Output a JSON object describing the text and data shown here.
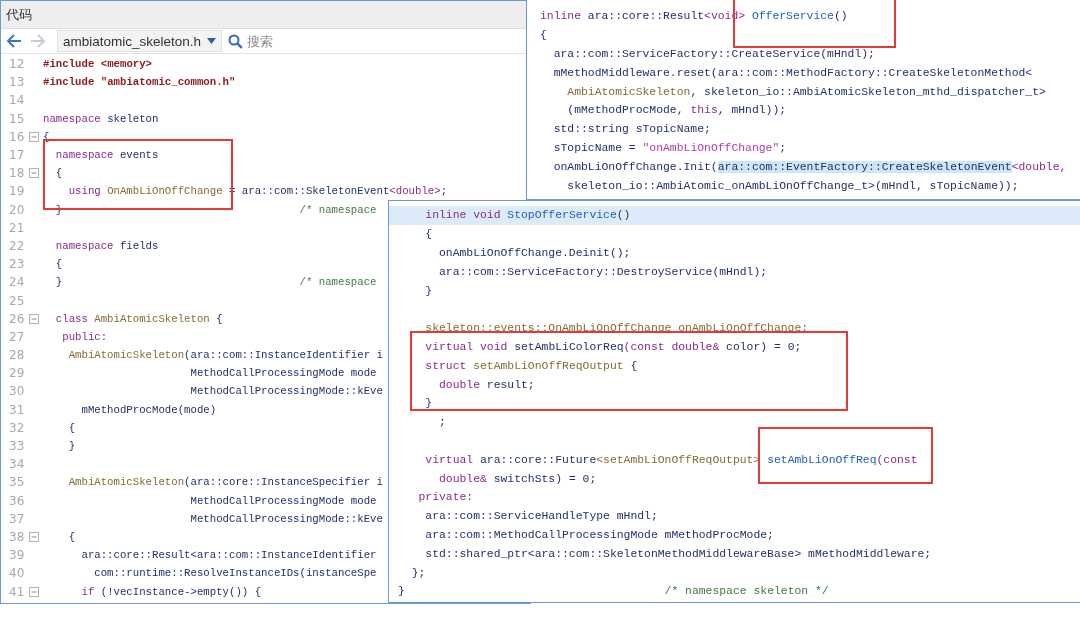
{
  "editor": {
    "title": "代码",
    "back_enabled": true,
    "forward_enabled": false,
    "file": "ambiatomic_skeleton.h",
    "search_placeholder": "搜索",
    "lines": [
      {
        "number": "12",
        "code": [
          {
            "text": "#include <memory>",
            "kind": "pp"
          }
        ]
      },
      {
        "number": "13",
        "code": [
          {
            "text": "#include \"ambiatomic_common.h\"",
            "kind": "pp"
          }
        ]
      },
      {
        "number": "14"
      },
      {
        "number": "15",
        "code": [
          {
            "text": "namespace ",
            "kind": "kw"
          },
          {
            "text": "skeleton",
            "kind": "id"
          }
        ]
      },
      {
        "number": "16",
        "expanded": true,
        "code": [
          {
            "text": "{",
            "kind": "id"
          }
        ]
      },
      {
        "number": "17",
        "code": [
          {
            "text": "  namespace ",
            "kind": "kw"
          },
          {
            "text": "events",
            "kind": "id"
          }
        ]
      },
      {
        "number": "18",
        "expanded": true,
        "code": [
          {
            "text": "  {",
            "kind": "id"
          }
        ]
      },
      {
        "number": "19",
        "code": [
          {
            "text": "    using ",
            "kind": "kw"
          },
          {
            "text": "OnAmbLiOnOffChange",
            "kind": "ty"
          },
          {
            "text": " = ara::com::SkeletonEvent",
            "kind": "id"
          },
          {
            "text": "<double>",
            "kind": "kw"
          },
          {
            "text": ";",
            "kind": "id"
          }
        ]
      },
      {
        "number": "20",
        "code": [
          {
            "text": "  }                                     ",
            "kind": "id"
          },
          {
            "text": "/* namespace",
            "kind": "cm"
          }
        ]
      },
      {
        "number": "21"
      },
      {
        "number": "22",
        "code": [
          {
            "text": "  namespace ",
            "kind": "kw"
          },
          {
            "text": "fields",
            "kind": "id"
          }
        ]
      },
      {
        "number": "23",
        "code": [
          {
            "text": "  {",
            "kind": "id"
          }
        ]
      },
      {
        "number": "24",
        "code": [
          {
            "text": "  }                                     ",
            "kind": "id"
          },
          {
            "text": "/* namespace",
            "kind": "cm"
          }
        ]
      },
      {
        "number": "25"
      },
      {
        "number": "26",
        "expanded": true,
        "code": [
          {
            "text": "  class ",
            "kind": "kw"
          },
          {
            "text": "AmbiAtomicSkeleton",
            "kind": "ty"
          },
          {
            "text": " {",
            "kind": "id"
          }
        ]
      },
      {
        "number": "27",
        "code": [
          {
            "text": "   public:",
            "kind": "kw"
          }
        ]
      },
      {
        "number": "28",
        "code": [
          {
            "text": "    AmbiAtomicSkeleton",
            "kind": "ty"
          },
          {
            "text": "(ara::com::InstanceIdentifier i",
            "kind": "id"
          }
        ]
      },
      {
        "number": "29",
        "code": [
          {
            "text": "                       MethodCallProcessingMode mode",
            "kind": "id"
          }
        ]
      },
      {
        "number": "30",
        "code": [
          {
            "text": "                       MethodCallProcessingMode::kEve",
            "kind": "id"
          }
        ]
      },
      {
        "number": "31",
        "code": [
          {
            "text": "      mMethodProcMode(mode)",
            "kind": "id"
          }
        ]
      },
      {
        "number": "32",
        "code": [
          {
            "text": "    {",
            "kind": "id"
          }
        ]
      },
      {
        "number": "33",
        "code": [
          {
            "text": "    }",
            "kind": "id"
          }
        ]
      },
      {
        "number": "34"
      },
      {
        "number": "35",
        "code": [
          {
            "text": "    AmbiAtomicSkeleton",
            "kind": "ty"
          },
          {
            "text": "(ara::core::InstanceSpecifier i",
            "kind": "id"
          }
        ]
      },
      {
        "number": "36",
        "code": [
          {
            "text": "                       MethodCallProcessingMode mode",
            "kind": "id"
          }
        ]
      },
      {
        "number": "37",
        "code": [
          {
            "text": "                       MethodCallProcessingMode::kEve",
            "kind": "id"
          }
        ]
      },
      {
        "number": "38",
        "expanded": true,
        "code": [
          {
            "text": "    {",
            "kind": "id"
          }
        ]
      },
      {
        "number": "39",
        "code": [
          {
            "text": "      ara::core::Result<ara::com::InstanceIdentifier",
            "kind": "id"
          }
        ]
      },
      {
        "number": "40",
        "code": [
          {
            "text": "        com::runtime::ResolveInstanceIDs(instanceSpe",
            "kind": "id"
          }
        ]
      },
      {
        "number": "41",
        "expanded": true,
        "code": [
          {
            "text": "      if ",
            "kind": "kw"
          },
          {
            "text": "(!vecInstance->empty()) {",
            "kind": "id"
          }
        ]
      }
    ]
  },
  "panels": [
    {
      "lines": [
        {
          "code": [
            {
              "text": "inline ",
              "kind": "kw"
            },
            {
              "text": "ara::core::Result",
              "kind": "id"
            },
            {
              "text": "<void>",
              "kind": "kw"
            },
            {
              "text": " OfferService",
              "kind": "fn"
            },
            {
              "text": "()",
              "kind": "id"
            }
          ]
        },
        {
          "code": [
            {
              "text": "{",
              "kind": "id"
            }
          ]
        },
        {
          "code": [
            {
              "text": "  ara::com::ServiceFactory::CreateService(mHndl);",
              "kind": "id"
            }
          ]
        },
        {
          "code": [
            {
              "text": "  mMethodMiddleware.reset(ara::com::MethodFactory::CreateSkeletonMethod<",
              "kind": "id"
            }
          ]
        },
        {
          "code": [
            {
              "text": "    AmbiAtomicSkeleton",
              "kind": "ty"
            },
            {
              "text": ", skeleton_io::AmbiAtomicSkeleton_mthd_dispatcher_t>",
              "kind": "id"
            }
          ]
        },
        {
          "code": [
            {
              "text": "    (mMethodProcMode, ",
              "kind": "id"
            },
            {
              "text": "this",
              "kind": "kw"
            },
            {
              "text": ", mHndl));",
              "kind": "id"
            }
          ]
        },
        {
          "code": [
            {
              "text": "  std::string sTopicName;",
              "kind": "id"
            }
          ]
        },
        {
          "code": [
            {
              "text": "  sTopicName = ",
              "kind": "id"
            },
            {
              "text": "\"onAmbLiOnOffChange\"",
              "kind": "str"
            },
            {
              "text": ";",
              "kind": "id"
            }
          ]
        },
        {
          "code": [
            {
              "text": "  onAmbLiOnOffChange.Init(",
              "kind": "id"
            },
            {
              "text": "ara::com::EventFactory::CreateSkeletonEvent",
              "kind": "hl"
            },
            {
              "text": "<double,",
              "kind": "kw"
            }
          ]
        },
        {
          "code": [
            {
              "text": "    skeleton_io::AmbiAtomic_onAmbLiOnOffChange_t>(mHndl, sTopicName));",
              "kind": "id"
            }
          ]
        }
      ]
    },
    {
      "lines": [
        {
          "current": true,
          "code": [
            {
              "text": "    inline void ",
              "kind": "kw"
            },
            {
              "text": "StopOfferService",
              "kind": "fn"
            },
            {
              "text": "()",
              "kind": "id"
            }
          ]
        },
        {
          "current": false,
          "code": [
            {
              "text": "    {",
              "kind": "id"
            }
          ]
        },
        {
          "current": false,
          "code": [
            {
              "text": "      onAmbLiOnOffChange.Deinit();",
              "kind": "id"
            }
          ]
        },
        {
          "current": false,
          "code": [
            {
              "text": "      ara::com::ServiceFactory::DestroyService(mHndl);",
              "kind": "id"
            }
          ]
        },
        {
          "current": false,
          "code": [
            {
              "text": "    }",
              "kind": "id"
            }
          ]
        },
        {
          "current": false
        },
        {
          "current": false,
          "code": [
            {
              "text": "    skeleton::events::OnAmbLiOnOffChange onAmbLiOnOffChange;",
              "kind": "ty"
            }
          ]
        },
        {
          "current": false,
          "code": [
            {
              "text": "    virtual void ",
              "kind": "kw"
            },
            {
              "text": "setAmbLiColorReq",
              "kind": "id"
            },
            {
              "text": "(const double&",
              "kind": "kw"
            },
            {
              "text": " color) = 0;",
              "kind": "id"
            }
          ]
        },
        {
          "current": false,
          "code": [
            {
              "text": "    struct ",
              "kind": "kw"
            },
            {
              "text": "setAmbLiOnOffReqOutput",
              "kind": "ty"
            },
            {
              "text": " {",
              "kind": "id"
            }
          ]
        },
        {
          "current": false,
          "code": [
            {
              "text": "      double ",
              "kind": "kw"
            },
            {
              "text": "result;",
              "kind": "id"
            }
          ]
        },
        {
          "current": false,
          "code": [
            {
              "text": "    }",
              "kind": "id"
            }
          ]
        },
        {
          "current": false,
          "code": [
            {
              "text": "      ;",
              "kind": "id"
            }
          ]
        },
        {
          "current": false
        },
        {
          "current": false,
          "code": [
            {
              "text": "    virtual ",
              "kind": "kw"
            },
            {
              "text": "ara::core::Future",
              "kind": "id"
            },
            {
              "text": "<setAmbLiOnOffReqOutput>",
              "kind": "ty"
            },
            {
              "text": " setAmbLiOnOffReq",
              "kind": "fn"
            },
            {
              "text": "(const",
              "kind": "kw"
            }
          ]
        },
        {
          "current": false,
          "code": [
            {
              "text": "      double& ",
              "kind": "kw"
            },
            {
              "text": "switchSts) = 0;",
              "kind": "id"
            }
          ]
        },
        {
          "current": false,
          "code": [
            {
              "text": "   private:",
              "kind": "kw"
            }
          ]
        },
        {
          "current": false,
          "code": [
            {
              "text": "    ara::com::ServiceHandleType mHndl;",
              "kind": "id"
            }
          ]
        },
        {
          "current": false,
          "code": [
            {
              "text": "    ara::com::MethodCallProcessingMode mMethodProcMode;",
              "kind": "id"
            }
          ]
        },
        {
          "current": false,
          "code": [
            {
              "text": "    std::shared_ptr<ara::com::SkeletonMethodMiddlewareBase> mMethodMiddleware;",
              "kind": "id"
            }
          ]
        },
        {
          "current": false,
          "code": [
            {
              "text": "  };",
              "kind": "id"
            }
          ]
        },
        {
          "current": false,
          "code": [
            {
              "text": "}                                      ",
              "kind": "id"
            },
            {
              "text": "/* namespace skeleton */",
              "kind": "cm"
            }
          ]
        }
      ]
    }
  ]
}
